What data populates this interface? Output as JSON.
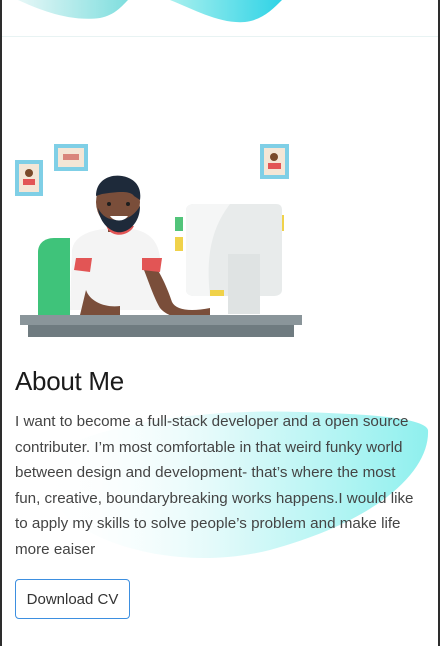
{
  "about": {
    "title": "About Me",
    "paragraph": "I want to become a full-stack developer and a open source contributer. I’m most comfortable in that weird funky world between design and development- that’s where the most fun, creative, boundarybreaking works happens.I would like to apply my skills to solve people’s problem and make life more eaiser",
    "download_label": "Download CV"
  },
  "colors": {
    "accent_blue": "#3d8fe0",
    "blob_cyan": "#5ce6e6",
    "frame_dark": "#2d2d2d"
  },
  "icons": {
    "hero": "developer-at-desk-illustration"
  }
}
